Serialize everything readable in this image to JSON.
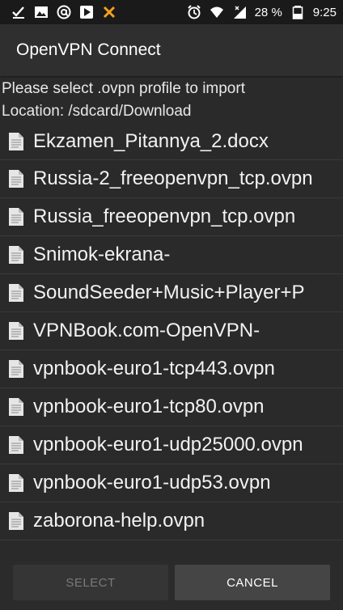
{
  "status_bar": {
    "left_icons": [
      "download-done-icon",
      "image-icon",
      "at-sign-icon",
      "play-store-icon",
      "x-app-icon"
    ],
    "right_icons": [
      "alarm-icon",
      "wifi-icon",
      "signal-icon",
      "battery-icon"
    ],
    "battery_percent": "28 %",
    "time": "9:25"
  },
  "app_bar": {
    "title": "OpenVPN Connect"
  },
  "dialog": {
    "prompt": "Please select .ovpn profile to import",
    "location": "Location: /sdcard/Download",
    "files": [
      "Ekzamen_Pitannya_2.docx",
      "Russia-2_freeopenvpn_tcp.ovpn",
      "Russia_freeopenvpn_tcp.ovpn",
      "Snimok-ekrana-",
      "SoundSeeder+Music+Player+P",
      "VPNBook.com-OpenVPN-",
      "vpnbook-euro1-tcp443.ovpn",
      "vpnbook-euro1-tcp80.ovpn",
      "vpnbook-euro1-udp25000.ovpn",
      "vpnbook-euro1-udp53.ovpn",
      "zaborona-help.ovpn"
    ],
    "select_label": "SELECT",
    "cancel_label": "CANCEL"
  }
}
